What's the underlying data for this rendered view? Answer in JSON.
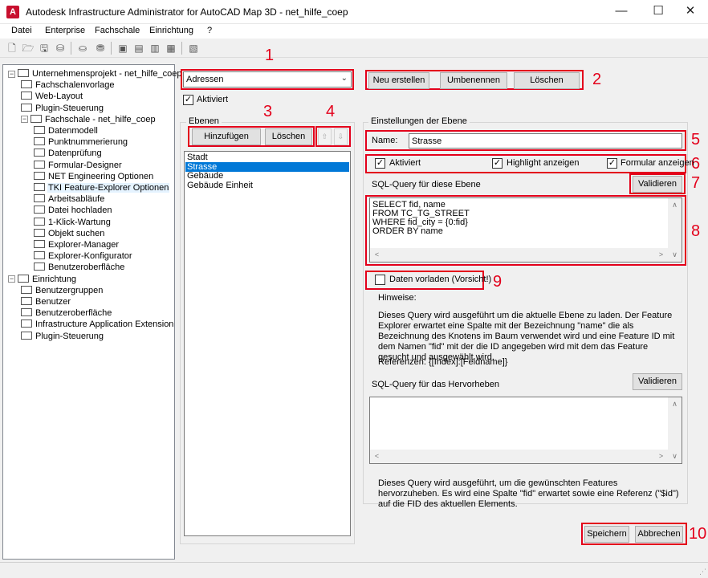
{
  "window": {
    "title": "Autodesk Infrastructure Administrator for AutoCAD Map 3D - net_hilfe_coep",
    "app_icon_letter": "A",
    "minimize": "—",
    "maximize": "☐",
    "close": "✕"
  },
  "menu": [
    "Datei",
    "Enterprise",
    "Fachschale",
    "Einrichtung",
    "?"
  ],
  "toolbar_icons": [
    "new-icon",
    "open-icon",
    "save-icon",
    "save-all-icon",
    "db-add-icon",
    "db-remove-icon",
    "module-icon",
    "module-add-icon",
    "module-delete-icon",
    "module-edit-icon",
    "report-icon"
  ],
  "tree": [
    {
      "label": "Unternehmensprojekt - net_hilfe_coep",
      "level": 0,
      "expander": "−"
    },
    {
      "label": "Fachschalenvorlage",
      "level": 1
    },
    {
      "label": "Web-Layout",
      "level": 1
    },
    {
      "label": "Plugin-Steuerung",
      "level": 1
    },
    {
      "label": "Fachschale - net_hilfe_coep",
      "level": 1,
      "expander": "−"
    },
    {
      "label": "Datenmodell",
      "level": 2
    },
    {
      "label": "Punktnummerierung",
      "level": 2
    },
    {
      "label": "Datenprüfung",
      "level": 2
    },
    {
      "label": "Formular-Designer",
      "level": 2
    },
    {
      "label": "NET Engineering Optionen",
      "level": 2
    },
    {
      "label": "TKI Feature-Explorer Optionen",
      "level": 2,
      "selected": true
    },
    {
      "label": "Arbeitsabläufe",
      "level": 2
    },
    {
      "label": "Datei hochladen",
      "level": 2
    },
    {
      "label": "1-Klick-Wartung",
      "level": 2
    },
    {
      "label": "Objekt suchen",
      "level": 2
    },
    {
      "label": "Explorer-Manager",
      "level": 2
    },
    {
      "label": "Explorer-Konfigurator",
      "level": 2
    },
    {
      "label": "Benutzeroberfläche",
      "level": 2
    },
    {
      "label": "Einrichtung",
      "level": 0,
      "expander": "−"
    },
    {
      "label": "Benutzergruppen",
      "level": 1
    },
    {
      "label": "Benutzer",
      "level": 1
    },
    {
      "label": "Benutzeroberfläche",
      "level": 1
    },
    {
      "label": "Infrastructure Application Extension",
      "level": 1
    },
    {
      "label": "Plugin-Steuerung",
      "level": 1
    }
  ],
  "explorer": {
    "selected": "Adressen",
    "active_label": "Aktiviert",
    "new_button": "Neu erstellen",
    "rename_button": "Umbenennen",
    "delete_button": "Löschen"
  },
  "layers": {
    "group_title": "Ebenen",
    "add_button": "Hinzufügen",
    "delete_button": "Löschen",
    "up_button": "⇧",
    "down_button": "⇩",
    "items": [
      "Stadt",
      "Strasse",
      "Gebäude",
      "Gebäude Einheit"
    ],
    "selected_index": 1
  },
  "settings": {
    "group_title": "Einstellungen der Ebene",
    "name_label": "Name:",
    "name_value": "Strasse",
    "active_label": "Aktiviert",
    "highlight_label": "Highlight anzeigen",
    "form_label": "Formular anzeigen",
    "sql_label": "SQL-Query für diese Ebene",
    "validate_button": "Validieren",
    "sql_lines": [
      "SELECT fid, name",
      "FROM TC_TG_STREET",
      "WHERE fid_city = {0:fid}",
      "ORDER BY name"
    ],
    "preload_label": "Daten vorladen (Vorsicht!)",
    "hints_title": "Hinweise:",
    "hints_text": "Dieses Query wird ausgeführt um die aktuelle Ebene zu laden. Der Feature Explorer erwartet eine Spalte mit der Bezeichnung \"name\" die als Bezeichnung des Knotens im Baum verwendet wird und eine Feature ID mit dem Namen \"fid\" mit der die ID angegeben wird mit dem das Feature gesucht und ausgewählt wird.",
    "references": "Referenzen: {[Index]:[Feldname]}",
    "highlight_sql_label": "SQL-Query für das Hervorheben",
    "highlight_validate_button": "Validieren",
    "highlight_hint": "Dieses Query wird ausgeführt, um die gewünschten Features hervorzuheben. Es wird eine Spalte \"fid\" erwartet sowie eine Referenz (\"$id\") auf die FID des aktuellen Elements."
  },
  "footer": {
    "save_button": "Speichern",
    "cancel_button": "Abbrechen"
  },
  "markers": [
    "1",
    "2",
    "3",
    "4",
    "5",
    "6",
    "7",
    "8",
    "9",
    "10"
  ],
  "colors": {
    "highlight_red": "#e3001b",
    "selection_blue": "#0078d7"
  }
}
